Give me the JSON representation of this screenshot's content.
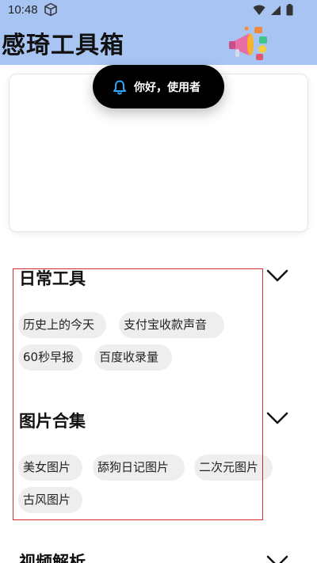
{
  "status_bar": {
    "time": "10:48"
  },
  "header": {
    "title": "感琦工具箱"
  },
  "toast": {
    "message": "你好，使用者"
  },
  "sections": [
    {
      "title": "日常工具",
      "items": [
        "历史上的今天",
        "支付宝收款声音",
        "60秒早报",
        "百度收录量"
      ]
    },
    {
      "title": "图片合集",
      "items": [
        "美女图片",
        "舔狗日记图片",
        "二次元图片",
        "古风图片"
      ]
    },
    {
      "title": "视频解析"
    }
  ],
  "colors": {
    "header_bg": "#a8c4f2",
    "accent_bell": "#2aa8ff",
    "chip_bg": "#eeeeee",
    "highlight": "#d62b2b"
  }
}
